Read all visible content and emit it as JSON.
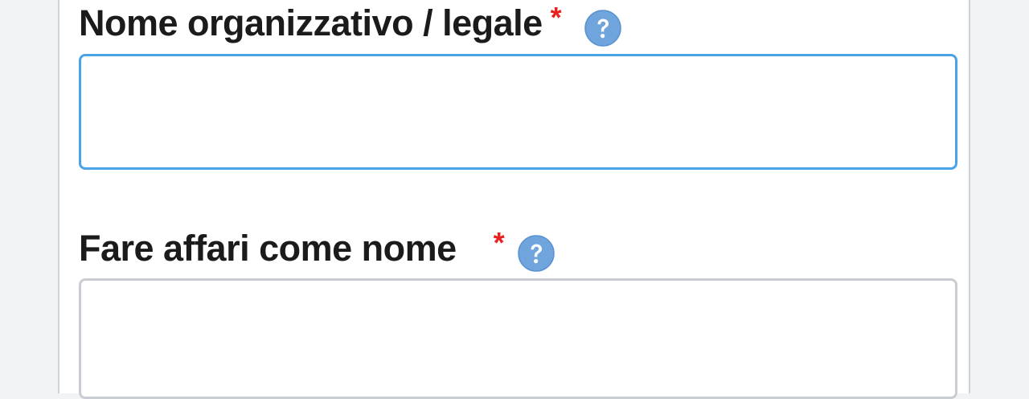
{
  "form": {
    "fields": [
      {
        "label": "Nome organizzativo / legale",
        "required_marker": "*",
        "help_icon": "question-circle-icon",
        "value": "",
        "placeholder": "",
        "state": "focused"
      },
      {
        "label": "Fare affari come nome",
        "required_marker": "*",
        "help_icon": "question-circle-icon",
        "value": "",
        "placeholder": "",
        "state": "default"
      }
    ]
  },
  "colors": {
    "required": "#e8201e",
    "help_icon": "#6fa4dc",
    "focus_border": "#4aa3e6",
    "default_border": "#c9cdd3",
    "label_text": "#1b1b1b",
    "page_background": "#f2f3f5"
  }
}
